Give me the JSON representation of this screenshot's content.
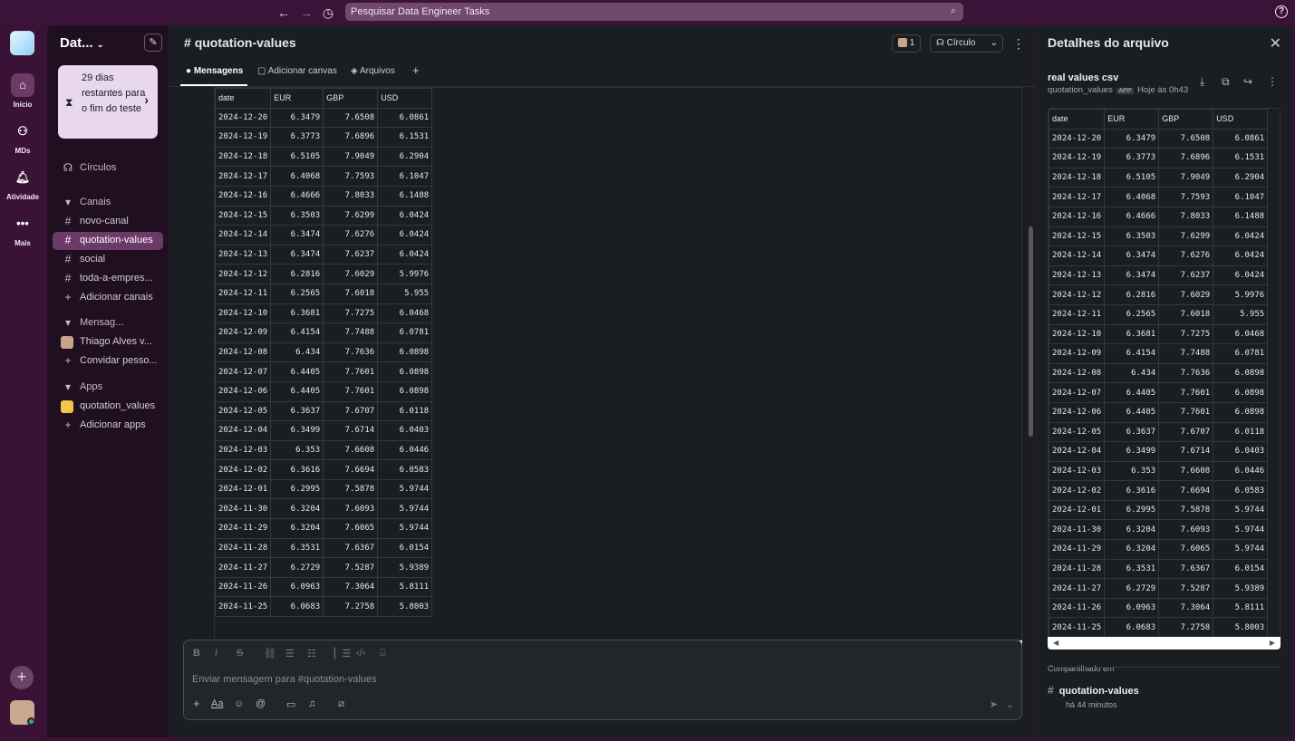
{
  "topbar": {
    "search_placeholder": "Pesquisar Data Engineer Tasks"
  },
  "rail": {
    "items": [
      {
        "label": "Início",
        "icon": "home-icon"
      },
      {
        "label": "MDs",
        "icon": "chat-icon"
      },
      {
        "label": "Atividade",
        "icon": "bell-icon"
      },
      {
        "label": "Mais",
        "icon": "dots-icon"
      }
    ]
  },
  "sidebar": {
    "workspace": "Dat...",
    "trial": "29 dias restantes para o fim do teste",
    "circles": "Círculos",
    "channels_header": "Canais",
    "channels": [
      "novo-canal",
      "quotation-values",
      "social",
      "toda-a-empres..."
    ],
    "add_channels": "Adicionar canais",
    "dm_header": "Mensag...",
    "dm_user": "Thiago Alves  v...",
    "invite": "Convidar pesso...",
    "apps_header": "Apps",
    "app": "quotation_values",
    "add_apps": "Adicionar apps"
  },
  "channel": {
    "name": "quotation-values",
    "members": "1",
    "huddle": "Círculo",
    "tabs": [
      "Mensagens",
      "Adicionar canvas",
      "Arquivos"
    ],
    "composer_placeholder": "Enviar mensagem para #quotation-values"
  },
  "table": {
    "headers": [
      "date",
      "EUR",
      "GBP",
      "USD"
    ],
    "rows": [
      [
        "2024-12-20",
        "6.3479",
        "7.6508",
        "6.0861"
      ],
      [
        "2024-12-19",
        "6.3773",
        "7.6896",
        "6.1531"
      ],
      [
        "2024-12-18",
        "6.5105",
        "7.9049",
        "6.2904"
      ],
      [
        "2024-12-17",
        "6.4068",
        "7.7593",
        "6.1047"
      ],
      [
        "2024-12-16",
        "6.4666",
        "7.8033",
        "6.1488"
      ],
      [
        "2024-12-15",
        "6.3503",
        "7.6299",
        "6.0424"
      ],
      [
        "2024-12-14",
        "6.3474",
        "7.6276",
        "6.0424"
      ],
      [
        "2024-12-13",
        "6.3474",
        "7.6237",
        "6.0424"
      ],
      [
        "2024-12-12",
        "6.2816",
        "7.6029",
        "5.9976"
      ],
      [
        "2024-12-11",
        "6.2565",
        "7.6018",
        "5.955"
      ],
      [
        "2024-12-10",
        "6.3681",
        "7.7275",
        "6.0468"
      ],
      [
        "2024-12-09",
        "6.4154",
        "7.7488",
        "6.0781"
      ],
      [
        "2024-12-08",
        "6.434",
        "7.7636",
        "6.0898"
      ],
      [
        "2024-12-07",
        "6.4405",
        "7.7601",
        "6.0898"
      ],
      [
        "2024-12-06",
        "6.4405",
        "7.7601",
        "6.0898"
      ],
      [
        "2024-12-05",
        "6.3637",
        "7.6707",
        "6.0118"
      ],
      [
        "2024-12-04",
        "6.3499",
        "7.6714",
        "6.0403"
      ],
      [
        "2024-12-03",
        "6.353",
        "7.6608",
        "6.0446"
      ],
      [
        "2024-12-02",
        "6.3616",
        "7.6694",
        "6.0583"
      ],
      [
        "2024-12-01",
        "6.2995",
        "7.5878",
        "5.9744"
      ],
      [
        "2024-11-30",
        "6.3204",
        "7.6093",
        "5.9744"
      ],
      [
        "2024-11-29",
        "6.3204",
        "7.6065",
        "5.9744"
      ],
      [
        "2024-11-28",
        "6.3531",
        "7.6367",
        "6.0154"
      ],
      [
        "2024-11-27",
        "6.2729",
        "7.5287",
        "5.9389"
      ],
      [
        "2024-11-26",
        "6.0963",
        "7.3064",
        "5.8111"
      ],
      [
        "2024-11-25",
        "6.0683",
        "7.2758",
        "5.8003"
      ]
    ]
  },
  "panel": {
    "title": "Detalhes do arquivo",
    "file_name": "real values csv",
    "file_source": "quotation_values",
    "badge": "APP",
    "file_time": "Hoje às 0h43",
    "shared_in": "Compartilhado em",
    "shared_channel": "quotation-values",
    "shared_time": "há 44 minutos"
  }
}
